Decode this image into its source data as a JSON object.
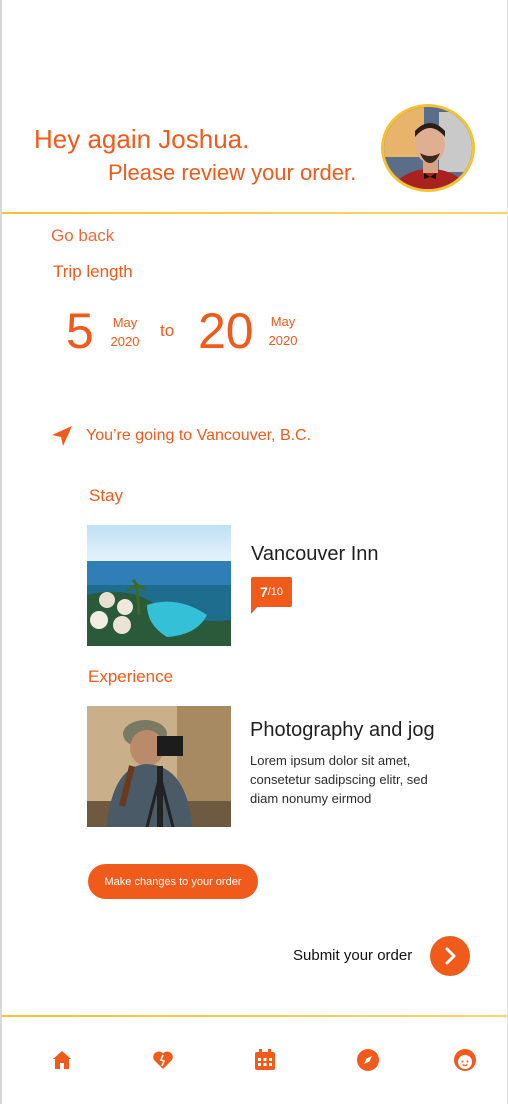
{
  "header": {
    "greeting": "Hey again Joshua.",
    "subtitle": "Please review your order.",
    "avatar_icon": "user-avatar"
  },
  "nav_back": "Go back",
  "trip": {
    "label": "Trip length",
    "start_day": "5",
    "start_month": "May",
    "start_year": "2020",
    "connector": "to",
    "end_day": "20",
    "end_month": "May",
    "end_year": "2020"
  },
  "destination": {
    "prefix": "You’re going to",
    "place": "Vancouver, B.C.",
    "icon": "location-arrow-icon"
  },
  "stay": {
    "section_label": "Stay",
    "name": "Vancouver Inn",
    "rating": "7",
    "rating_scale": "/10"
  },
  "experience": {
    "section_label": "Experience",
    "title": "Photography and jog",
    "description": "Lorem ipsum dolor sit amet, consetetur sadipscing elitr, sed diam nonumy eirmod"
  },
  "actions": {
    "changes_label": "Make changes to your order",
    "submit_label": "Submit your order"
  },
  "bottom_nav": [
    "home-icon",
    "heart-icon",
    "calendar-icon",
    "compass-icon",
    "profile-face-icon"
  ],
  "colors": {
    "accent": "#f05a1a",
    "divider": "#f5c233"
  }
}
